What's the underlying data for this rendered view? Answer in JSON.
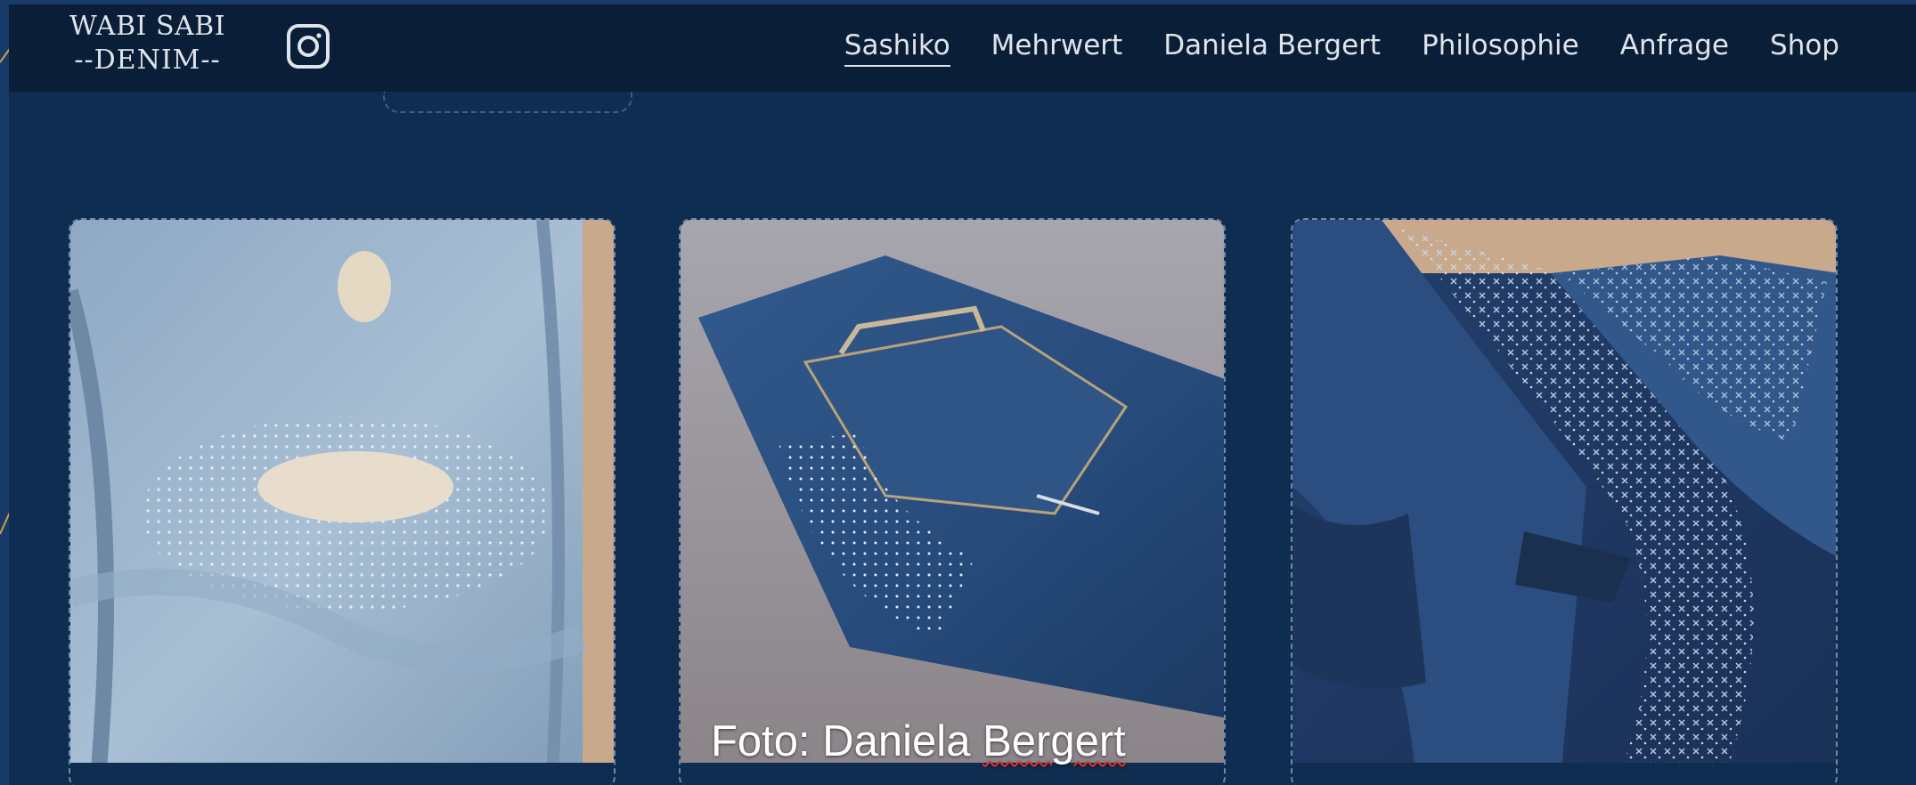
{
  "brand": {
    "logo_line1": "WABI SABI",
    "logo_line2": "--DENIM--"
  },
  "nav": {
    "items": [
      {
        "label": "Sashiko",
        "active": true
      },
      {
        "label": "Mehrwert",
        "active": false
      },
      {
        "label": "Daniela Bergert",
        "active": false
      },
      {
        "label": "Philosophie",
        "active": false
      },
      {
        "label": "Anfrage",
        "active": false
      },
      {
        "label": "Shop",
        "active": false
      }
    ]
  },
  "gallery": {
    "photo_credit_prefix": "Foto: Daniela ",
    "photo_credit_name": "Bergert"
  },
  "colors": {
    "page_bg": "#0f2c51",
    "navbar_bg": "#0b1e37",
    "nav_text": "#dfe4ea",
    "slide_accent": "#c9a24a",
    "spellcheck_underline": "#e2332a"
  },
  "icons": {
    "social": "instagram-icon"
  }
}
